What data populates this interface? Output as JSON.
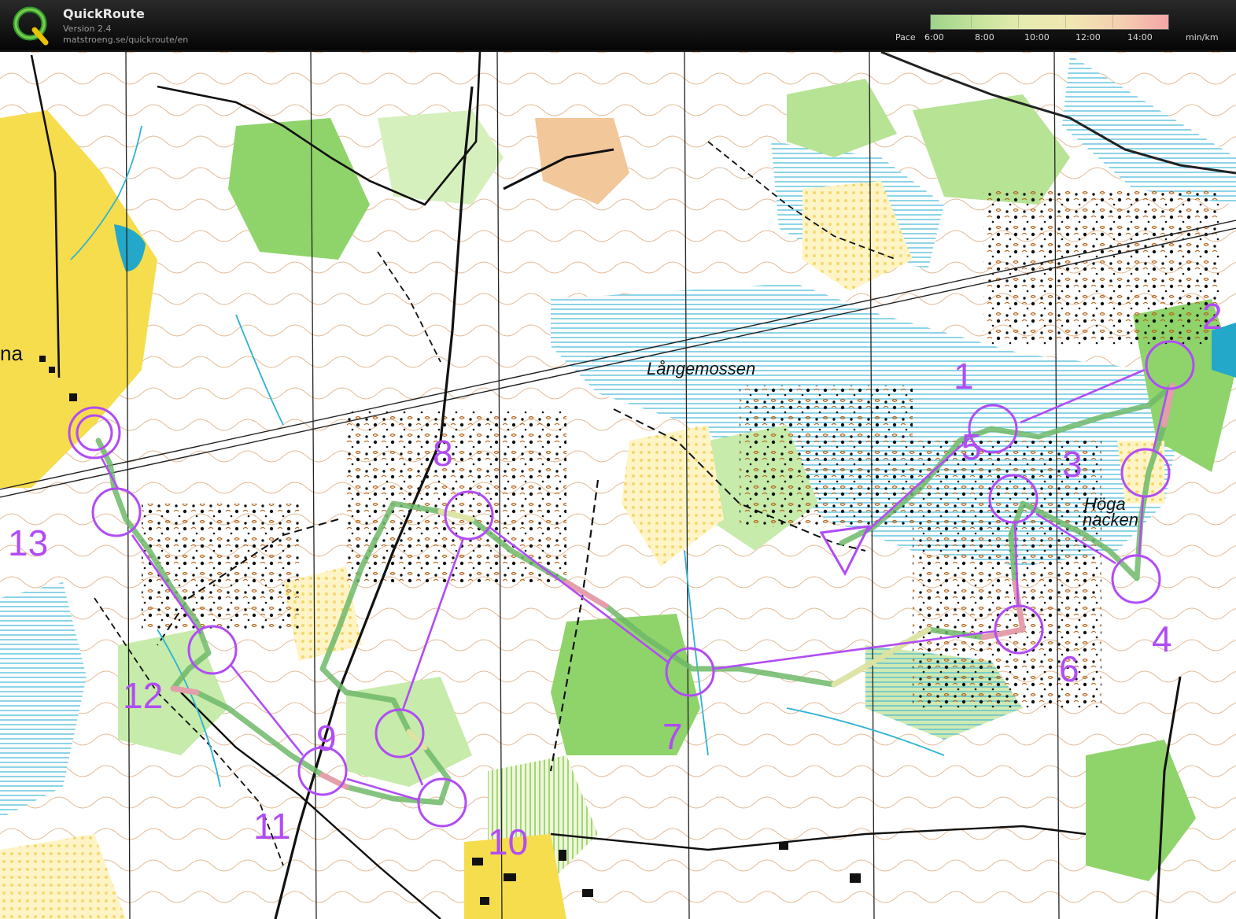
{
  "app": {
    "title": "QuickRoute",
    "version": "Version 2.4",
    "url": "matstroeng.se/quickroute/en",
    "logo_icon": "quickroute-q-logo-icon"
  },
  "pace_legend": {
    "label": "Pace",
    "ticks": [
      "6:00",
      "8:00",
      "10:00",
      "12:00",
      "14:00"
    ],
    "unit": "min/km",
    "color_scale": [
      "#9fd38a",
      "#c7e49c",
      "#e6ecb0",
      "#f1e6b1",
      "#f4cfb0",
      "#f3a6a8"
    ]
  },
  "map": {
    "place_names": {
      "langemossen": "Långemossen",
      "hoga": "Höga",
      "nacken": "nacken",
      "na": "na"
    },
    "course_color": "#b14cf5",
    "controls": {
      "c1": "1",
      "c2": "2",
      "c3": "3",
      "c4": "4",
      "c5": "5",
      "c6": "6",
      "c7": "7",
      "c8": "8",
      "c9": "9",
      "c10": "10",
      "c11": "11",
      "c12": "12",
      "c13": "13"
    }
  }
}
